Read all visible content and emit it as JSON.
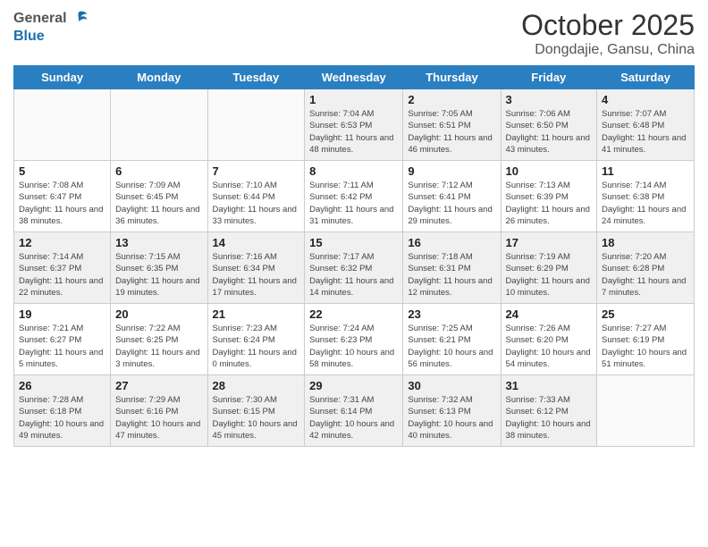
{
  "header": {
    "logo_general": "General",
    "logo_blue": "Blue",
    "month": "October 2025",
    "location": "Dongdajie, Gansu, China"
  },
  "days_of_week": [
    "Sunday",
    "Monday",
    "Tuesday",
    "Wednesday",
    "Thursday",
    "Friday",
    "Saturday"
  ],
  "weeks": [
    [
      {
        "num": "",
        "info": ""
      },
      {
        "num": "",
        "info": ""
      },
      {
        "num": "",
        "info": ""
      },
      {
        "num": "1",
        "info": "Sunrise: 7:04 AM\nSunset: 6:53 PM\nDaylight: 11 hours and 48 minutes."
      },
      {
        "num": "2",
        "info": "Sunrise: 7:05 AM\nSunset: 6:51 PM\nDaylight: 11 hours and 46 minutes."
      },
      {
        "num": "3",
        "info": "Sunrise: 7:06 AM\nSunset: 6:50 PM\nDaylight: 11 hours and 43 minutes."
      },
      {
        "num": "4",
        "info": "Sunrise: 7:07 AM\nSunset: 6:48 PM\nDaylight: 11 hours and 41 minutes."
      }
    ],
    [
      {
        "num": "5",
        "info": "Sunrise: 7:08 AM\nSunset: 6:47 PM\nDaylight: 11 hours and 38 minutes."
      },
      {
        "num": "6",
        "info": "Sunrise: 7:09 AM\nSunset: 6:45 PM\nDaylight: 11 hours and 36 minutes."
      },
      {
        "num": "7",
        "info": "Sunrise: 7:10 AM\nSunset: 6:44 PM\nDaylight: 11 hours and 33 minutes."
      },
      {
        "num": "8",
        "info": "Sunrise: 7:11 AM\nSunset: 6:42 PM\nDaylight: 11 hours and 31 minutes."
      },
      {
        "num": "9",
        "info": "Sunrise: 7:12 AM\nSunset: 6:41 PM\nDaylight: 11 hours and 29 minutes."
      },
      {
        "num": "10",
        "info": "Sunrise: 7:13 AM\nSunset: 6:39 PM\nDaylight: 11 hours and 26 minutes."
      },
      {
        "num": "11",
        "info": "Sunrise: 7:14 AM\nSunset: 6:38 PM\nDaylight: 11 hours and 24 minutes."
      }
    ],
    [
      {
        "num": "12",
        "info": "Sunrise: 7:14 AM\nSunset: 6:37 PM\nDaylight: 11 hours and 22 minutes."
      },
      {
        "num": "13",
        "info": "Sunrise: 7:15 AM\nSunset: 6:35 PM\nDaylight: 11 hours and 19 minutes."
      },
      {
        "num": "14",
        "info": "Sunrise: 7:16 AM\nSunset: 6:34 PM\nDaylight: 11 hours and 17 minutes."
      },
      {
        "num": "15",
        "info": "Sunrise: 7:17 AM\nSunset: 6:32 PM\nDaylight: 11 hours and 14 minutes."
      },
      {
        "num": "16",
        "info": "Sunrise: 7:18 AM\nSunset: 6:31 PM\nDaylight: 11 hours and 12 minutes."
      },
      {
        "num": "17",
        "info": "Sunrise: 7:19 AM\nSunset: 6:29 PM\nDaylight: 11 hours and 10 minutes."
      },
      {
        "num": "18",
        "info": "Sunrise: 7:20 AM\nSunset: 6:28 PM\nDaylight: 11 hours and 7 minutes."
      }
    ],
    [
      {
        "num": "19",
        "info": "Sunrise: 7:21 AM\nSunset: 6:27 PM\nDaylight: 11 hours and 5 minutes."
      },
      {
        "num": "20",
        "info": "Sunrise: 7:22 AM\nSunset: 6:25 PM\nDaylight: 11 hours and 3 minutes."
      },
      {
        "num": "21",
        "info": "Sunrise: 7:23 AM\nSunset: 6:24 PM\nDaylight: 11 hours and 0 minutes."
      },
      {
        "num": "22",
        "info": "Sunrise: 7:24 AM\nSunset: 6:23 PM\nDaylight: 10 hours and 58 minutes."
      },
      {
        "num": "23",
        "info": "Sunrise: 7:25 AM\nSunset: 6:21 PM\nDaylight: 10 hours and 56 minutes."
      },
      {
        "num": "24",
        "info": "Sunrise: 7:26 AM\nSunset: 6:20 PM\nDaylight: 10 hours and 54 minutes."
      },
      {
        "num": "25",
        "info": "Sunrise: 7:27 AM\nSunset: 6:19 PM\nDaylight: 10 hours and 51 minutes."
      }
    ],
    [
      {
        "num": "26",
        "info": "Sunrise: 7:28 AM\nSunset: 6:18 PM\nDaylight: 10 hours and 49 minutes."
      },
      {
        "num": "27",
        "info": "Sunrise: 7:29 AM\nSunset: 6:16 PM\nDaylight: 10 hours and 47 minutes."
      },
      {
        "num": "28",
        "info": "Sunrise: 7:30 AM\nSunset: 6:15 PM\nDaylight: 10 hours and 45 minutes."
      },
      {
        "num": "29",
        "info": "Sunrise: 7:31 AM\nSunset: 6:14 PM\nDaylight: 10 hours and 42 minutes."
      },
      {
        "num": "30",
        "info": "Sunrise: 7:32 AM\nSunset: 6:13 PM\nDaylight: 10 hours and 40 minutes."
      },
      {
        "num": "31",
        "info": "Sunrise: 7:33 AM\nSunset: 6:12 PM\nDaylight: 10 hours and 38 minutes."
      },
      {
        "num": "",
        "info": ""
      }
    ]
  ]
}
